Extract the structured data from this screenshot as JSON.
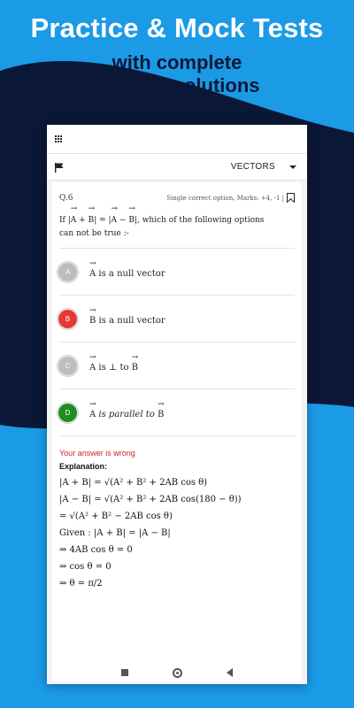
{
  "promo": {
    "headline": "Practice & Mock Tests",
    "subline1": "with complete",
    "subline2": "detailed solutions"
  },
  "toolbar": {
    "topic": "VECTORS",
    "grid_icon": "grid-menu-icon",
    "flag_icon": "flag-icon"
  },
  "question": {
    "number": "Q.6",
    "meta": "Single correct option, Marks: +4, -1 |",
    "text_prefix": "If |",
    "text_mid1": "+",
    "text_mid2": "| = |",
    "text_mid3": "−",
    "text_suffix": "|, which of the following options",
    "text_line2": "can not be true :-",
    "sym_a": "A",
    "sym_b": "B"
  },
  "options": [
    {
      "letter": "A",
      "vec": "A",
      "text": "is a null vector",
      "color": "#bdbdbd"
    },
    {
      "letter": "B",
      "vec": "B",
      "text": "is a null vector",
      "color": "#e53935"
    },
    {
      "letter": "C",
      "vec": "A",
      "text": "is ⊥ to",
      "vec2": "B",
      "color": "#bdbdbd"
    },
    {
      "letter": "D",
      "vec": "A",
      "text": "is parallel to",
      "vec2": "B",
      "color": "#1e8e1e"
    }
  ],
  "result": {
    "status": "Your answer is wrong",
    "explanation_title": "Explanation:"
  },
  "explanation": [
    "|A + B| = √(A² + B² + 2AB cos θ)",
    "|A − B| = √(A² + B² + 2AB cos(180 − θ))",
    "= √(A² + B² − 2AB cos θ)",
    "Given : |A + B| = |A − B|",
    "⇒ 4AB cos θ = 0",
    "⇒ cos θ = 0",
    "⇒ θ = π/2"
  ],
  "colors": {
    "background": "#1b9ae6",
    "dark_wave": "#0b1736",
    "wrong": "#d01f26"
  }
}
